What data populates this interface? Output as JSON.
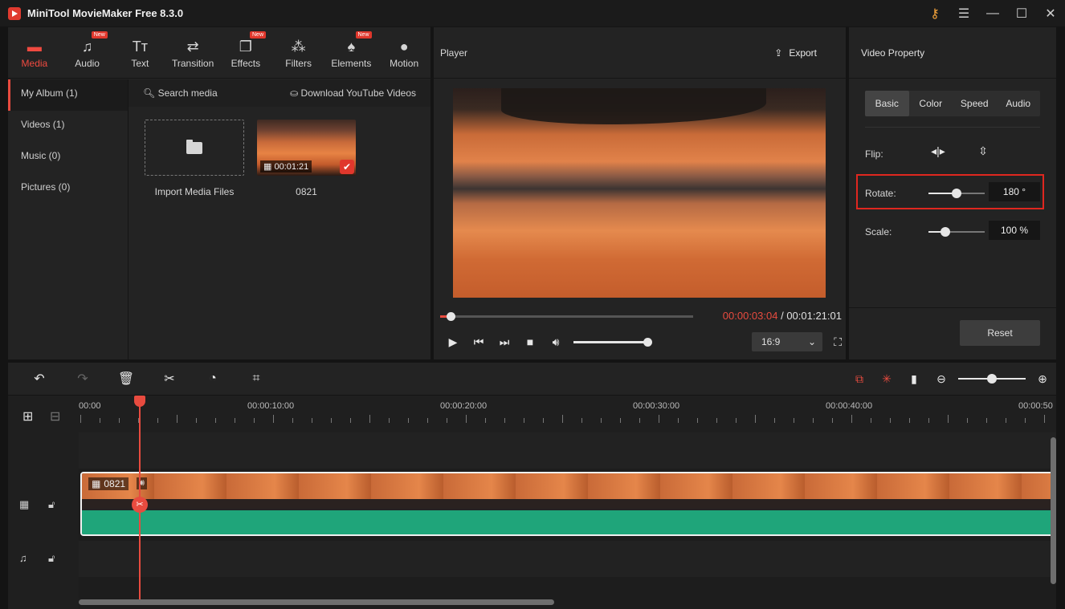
{
  "app": {
    "title": "MiniTool MovieMaker Free 8.3.0"
  },
  "toolbar": {
    "items": [
      {
        "label": "Media",
        "icon": "media-icon",
        "new": false
      },
      {
        "label": "Audio",
        "icon": "music-note-icon",
        "new": true
      },
      {
        "label": "Text",
        "icon": "text-icon",
        "new": false
      },
      {
        "label": "Transition",
        "icon": "transition-icon",
        "new": false
      },
      {
        "label": "Effects",
        "icon": "effects-icon",
        "new": true
      },
      {
        "label": "Filters",
        "icon": "filters-icon",
        "new": false
      },
      {
        "label": "Elements",
        "icon": "elements-icon",
        "new": true
      },
      {
        "label": "Motion",
        "icon": "motion-icon",
        "new": false
      }
    ],
    "new_badge": "New"
  },
  "albums": [
    {
      "label": "My Album (1)"
    },
    {
      "label": "Videos (1)"
    },
    {
      "label": "Music (0)"
    },
    {
      "label": "Pictures (0)"
    }
  ],
  "media": {
    "search_label": "Search media",
    "download_label": "Download YouTube Videos",
    "import_label": "Import Media Files",
    "clip_name": "0821",
    "clip_duration": "00:01:21"
  },
  "player": {
    "title": "Player",
    "export_label": "Export",
    "current_time": "00:00:03:04",
    "separator": " / ",
    "total_time": "00:01:21:01",
    "progress_fraction": 0.042,
    "volume_fraction": 1.0,
    "aspect_ratio": "16:9"
  },
  "property": {
    "title": "Video Property",
    "tabs": [
      "Basic",
      "Color",
      "Speed",
      "Audio"
    ],
    "active_tab": "Basic",
    "flip_label": "Flip:",
    "rotate_label": "Rotate:",
    "rotate_value": "180 °",
    "rotate_fraction": 0.5,
    "scale_label": "Scale:",
    "scale_value": "100 %",
    "scale_fraction": 0.3,
    "reset_label": "Reset"
  },
  "timeline": {
    "ruler_labels": [
      "00:00",
      "00:00:10:00",
      "00:00:20:00",
      "00:00:30:00",
      "00:00:40:00",
      "00:00:50"
    ],
    "clip_label": "0821",
    "zoom_fraction": 0.5
  },
  "colors": {
    "accent": "#e84b3f",
    "audio_wave": "#1fa57a",
    "highlight_box": "#e0271f"
  }
}
